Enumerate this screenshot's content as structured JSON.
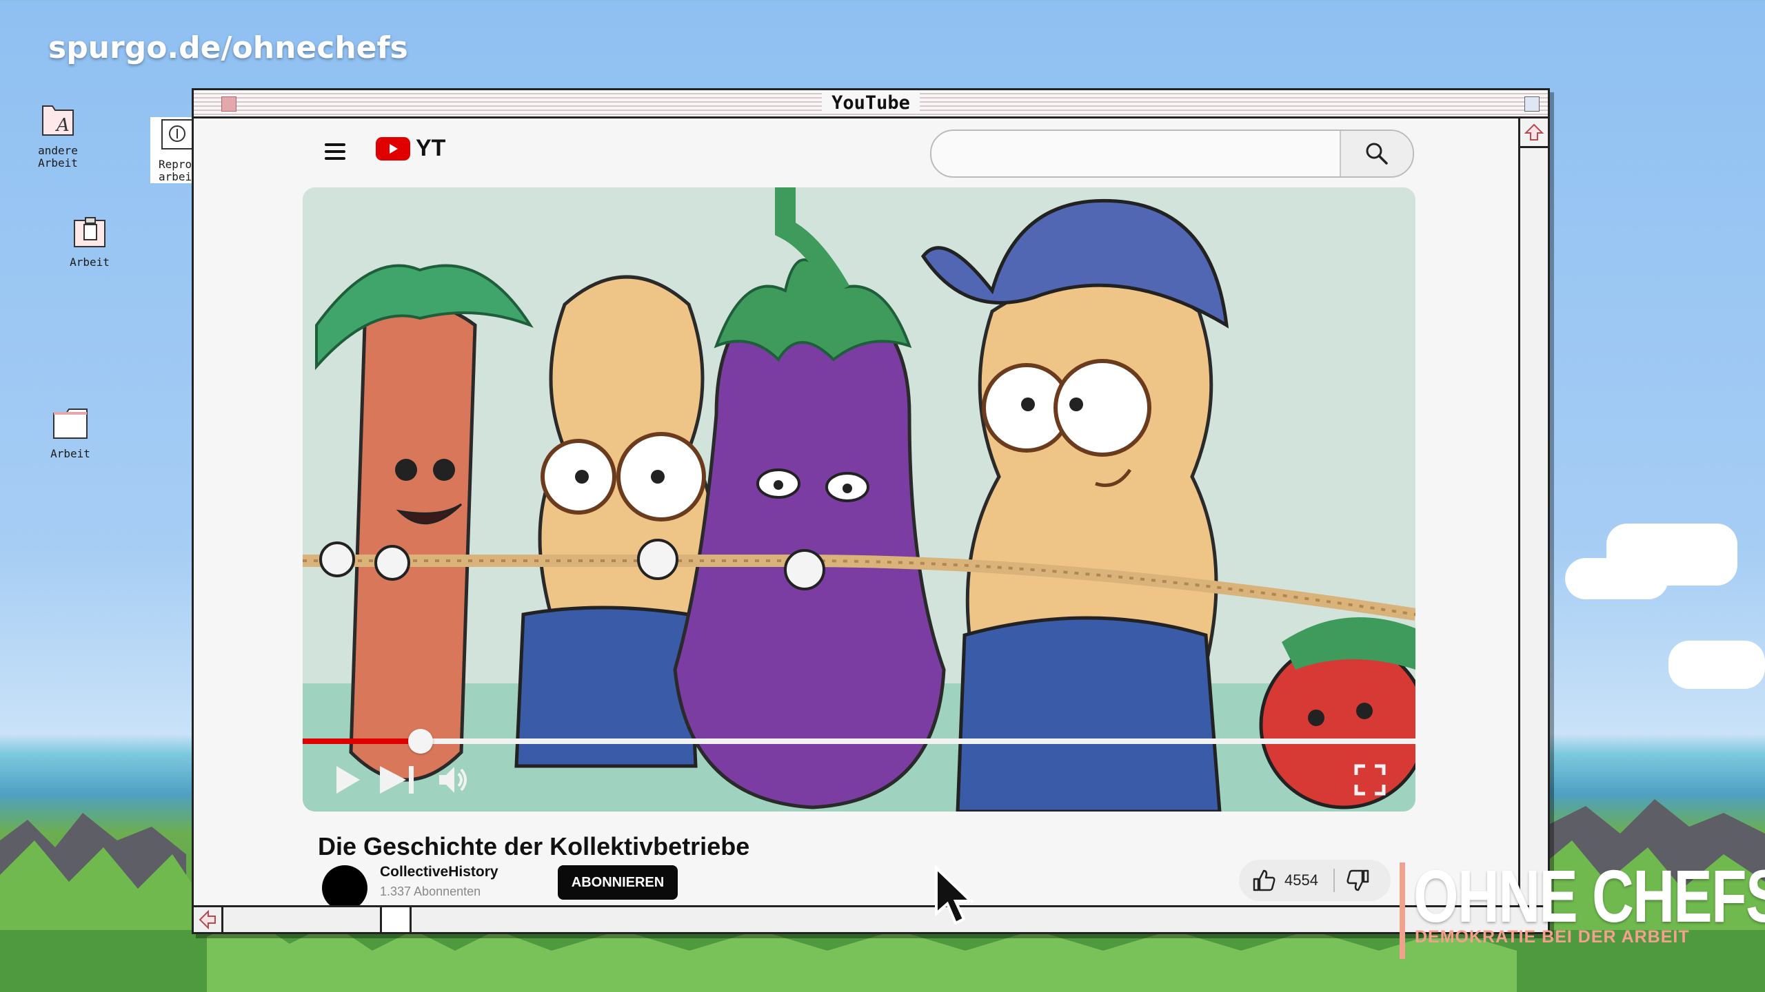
{
  "overlay": {
    "url_watermark": "spurgo.de/ohnechefs"
  },
  "desktop": {
    "icons": [
      {
        "label": "andere\nArbeit",
        "icon": "text-document-icon"
      },
      {
        "label": "Repro\narbei",
        "icon": "info-document-icon"
      },
      {
        "label": "Arbeit",
        "icon": "clipboard-document-icon"
      },
      {
        "label": "Arbeit",
        "icon": "folder-icon"
      }
    ]
  },
  "window": {
    "title": "YouTube"
  },
  "youtube": {
    "logo_text": "YT",
    "search": {
      "value": "",
      "placeholder": ""
    },
    "video": {
      "title": "Die Geschichte der Kollektivbetriebe",
      "progress": 0.106
    },
    "channel": {
      "name": "CollectiveHistory",
      "subscribers": "1.337 Abonnenten"
    },
    "subscribe_label": "ABONNIEREN",
    "likes": "4554"
  },
  "brand": {
    "name": "OHNE CHEFS",
    "tagline": "DEMOKRATIE BEI DER ARBEIT"
  },
  "colors": {
    "accent_red": "#e10000",
    "brand_pink": "#f3a18d"
  }
}
